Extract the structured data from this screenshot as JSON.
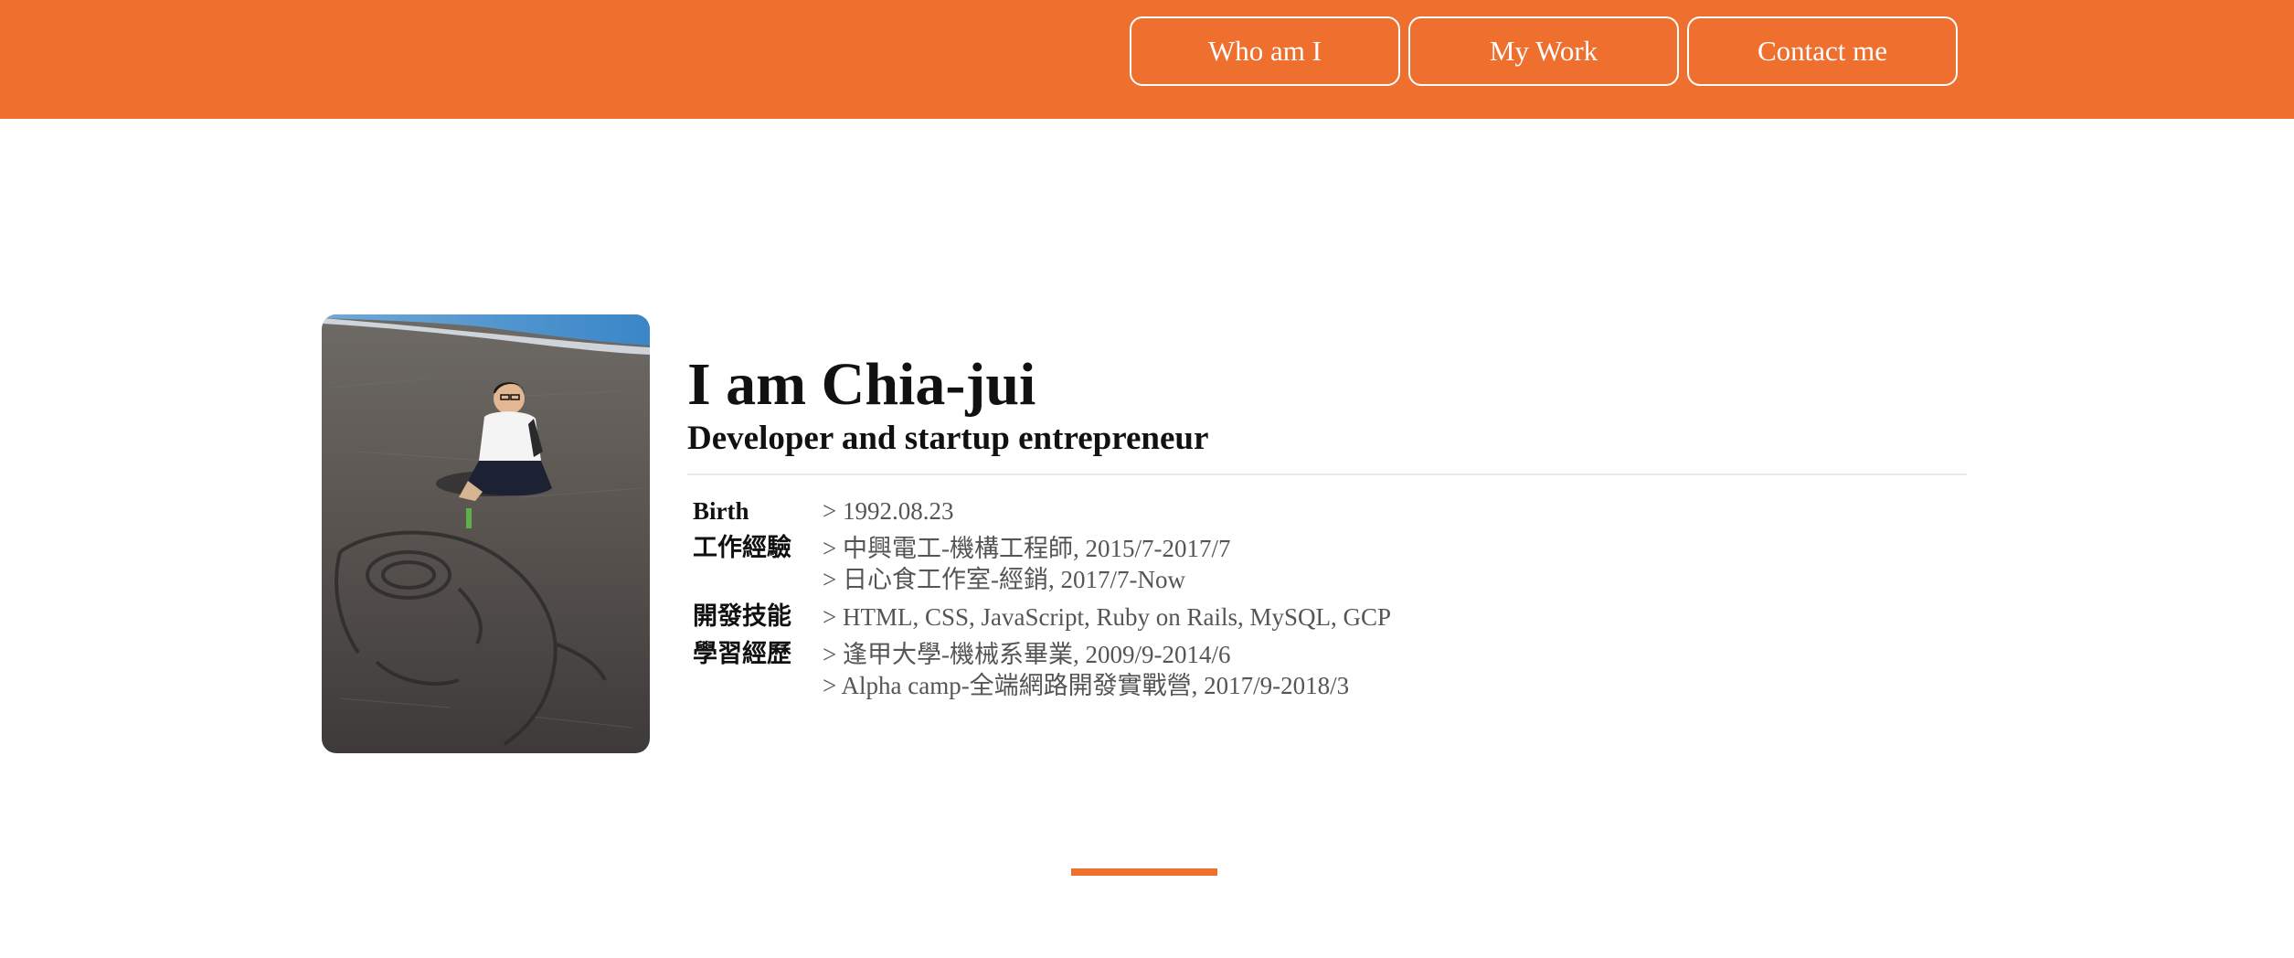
{
  "colors": {
    "accent": "#ef6f2e",
    "nav_border": "#ffffff",
    "text_primary": "#111111",
    "text_secondary": "#555555"
  },
  "nav": {
    "items": [
      {
        "label": "Who am I"
      },
      {
        "label": "My Work"
      },
      {
        "label": "Contact me"
      }
    ]
  },
  "profile": {
    "photo_icon": "profile-photo",
    "name": "I am Chia-jui",
    "tagline": "Developer and startup entrepreneur",
    "details": [
      {
        "label": "Birth",
        "values": [
          "> 1992.08.23"
        ]
      },
      {
        "label": "工作經驗",
        "values": [
          "> 中興電工-機構工程師, 2015/7-2017/7",
          "> 日心食工作室-經銷, 2017/7-Now"
        ]
      },
      {
        "label": "開發技能",
        "values": [
          "> HTML, CSS, JavaScript, Ruby on Rails, MySQL, GCP"
        ]
      },
      {
        "label": "學習經歷",
        "values": [
          "> 逢甲大學-機械系畢業, 2009/9-2014/6",
          "> Alpha camp-全端網路開發實戰營, 2017/9-2018/3"
        ]
      }
    ]
  }
}
